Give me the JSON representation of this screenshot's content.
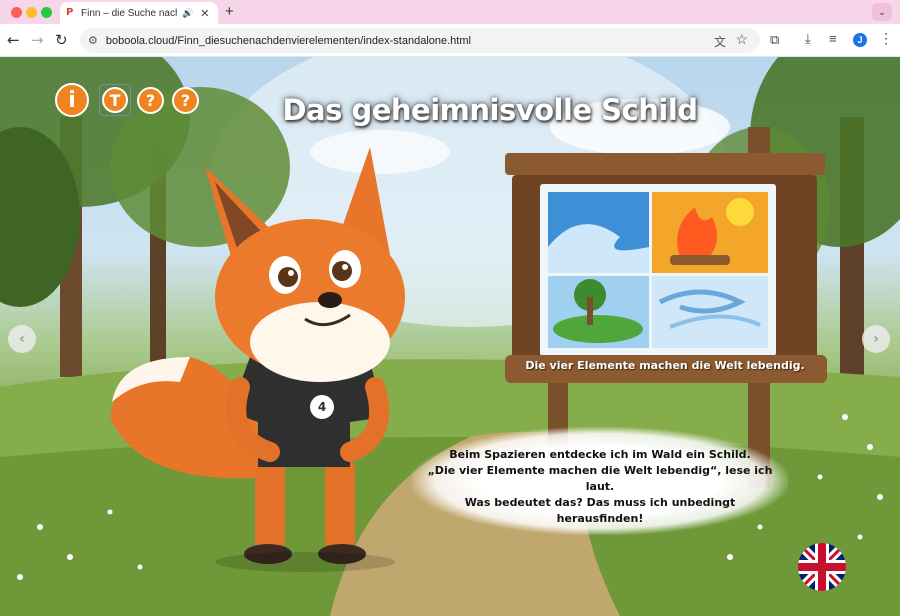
{
  "browser": {
    "tab": {
      "title": "Finn – die Suche nach den",
      "favicon": "boboola-favicon"
    },
    "address_bar": {
      "url": "boboola.cloud/Finn_diesuchenachdenvierelementen/index-standalone.html"
    },
    "profile_initial": "J",
    "icons": [
      "back-icon",
      "forward-icon",
      "reload-icon",
      "site-info-icon",
      "translate-icon",
      "star-icon",
      "extensions-icon",
      "download-icon",
      "media-icon",
      "more-icon",
      "audio-icon",
      "close-icon",
      "new-tab-icon"
    ]
  },
  "page": {
    "title": "Das geheimnisvolle Schild",
    "controls": {
      "info": "i",
      "text": "T",
      "help_1": "?",
      "help_2": "?"
    },
    "shirt_number": "4",
    "sign_caption": "Die vier Elemente machen die Welt lebendig.",
    "story_lines": [
      "Beim Spazieren entdecke ich im Wald ein Schild.",
      "„Die vier Elemente machen die Welt lebendig“, lese ich laut.",
      "Was bedeutet das? Das muss ich unbedingt herausfinden!"
    ],
    "nav": {
      "prev": "‹",
      "next": "›"
    },
    "language_flag": "uk-flag-icon"
  },
  "colors": {
    "tab_bar": "#f7d6ea",
    "accent_orange": "#f0841e",
    "title_text": "#ffffff"
  }
}
